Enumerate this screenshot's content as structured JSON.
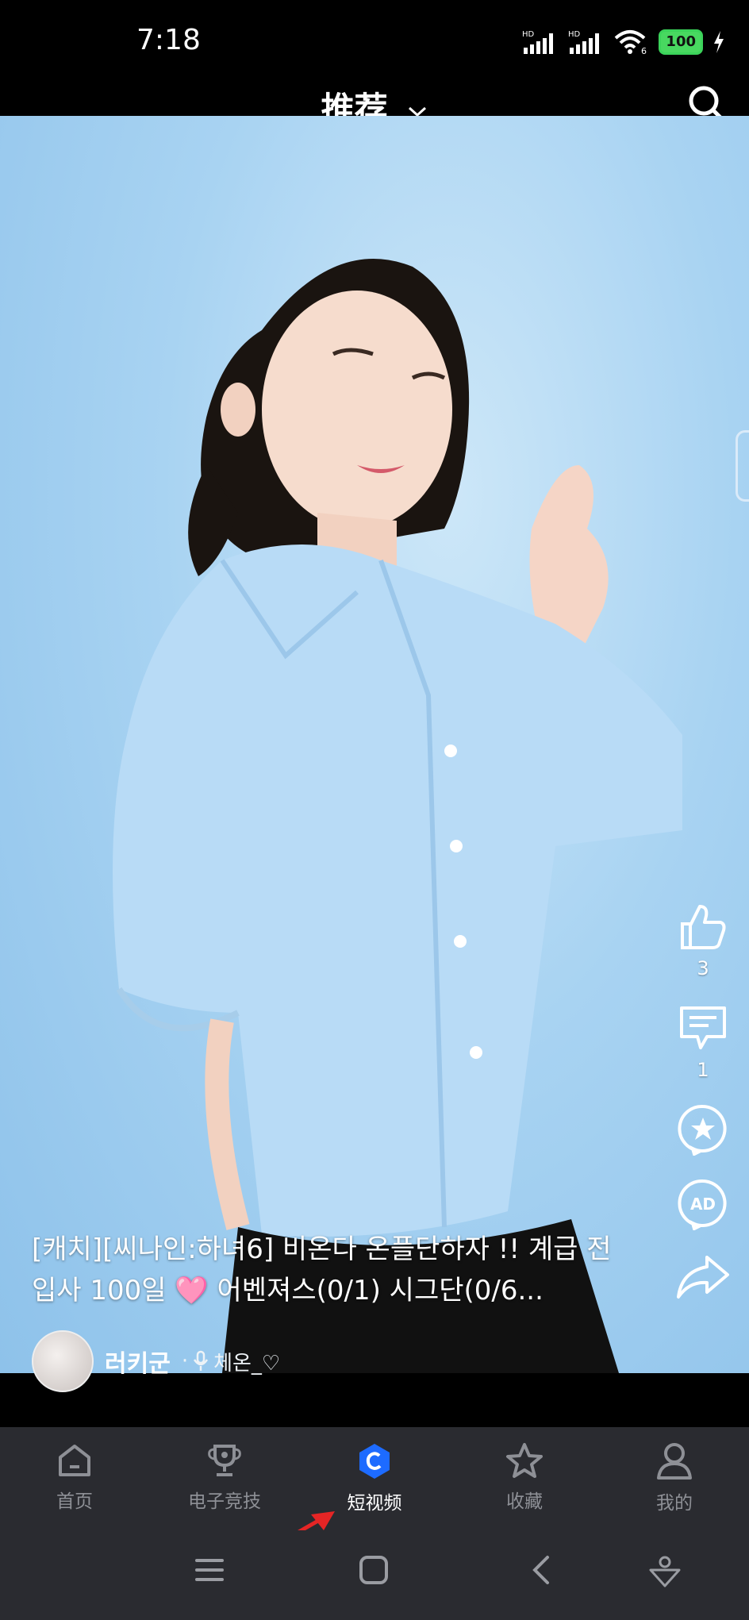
{
  "status": {
    "time": "7:18",
    "battery": "100",
    "signal1": "HD",
    "signal2": "HD",
    "wifi_badge": "6"
  },
  "header": {
    "title": "推荐"
  },
  "video": {
    "caption": "[캐치][씨나인:하녀6] 비온다 온플단하자 !! 계급 전 입사 100일 🩷 어벤져스(0/1) 시그단(0/6...",
    "author": "러키군",
    "author_separator": "·",
    "sub_author": "체온_♡",
    "likes": "3",
    "comments": "1"
  },
  "nav": {
    "items": [
      {
        "label": "首页",
        "icon": "home-icon"
      },
      {
        "label": "电子竞技",
        "icon": "trophy-icon"
      },
      {
        "label": "短视频",
        "icon": "short-video-icon",
        "active": true
      },
      {
        "label": "收藏",
        "icon": "star-icon"
      },
      {
        "label": "我的",
        "icon": "profile-icon"
      }
    ]
  },
  "colors": {
    "accent": "#1d6bff",
    "nav_bg": "#2a2b30",
    "annotation_arrow": "#e52525"
  }
}
